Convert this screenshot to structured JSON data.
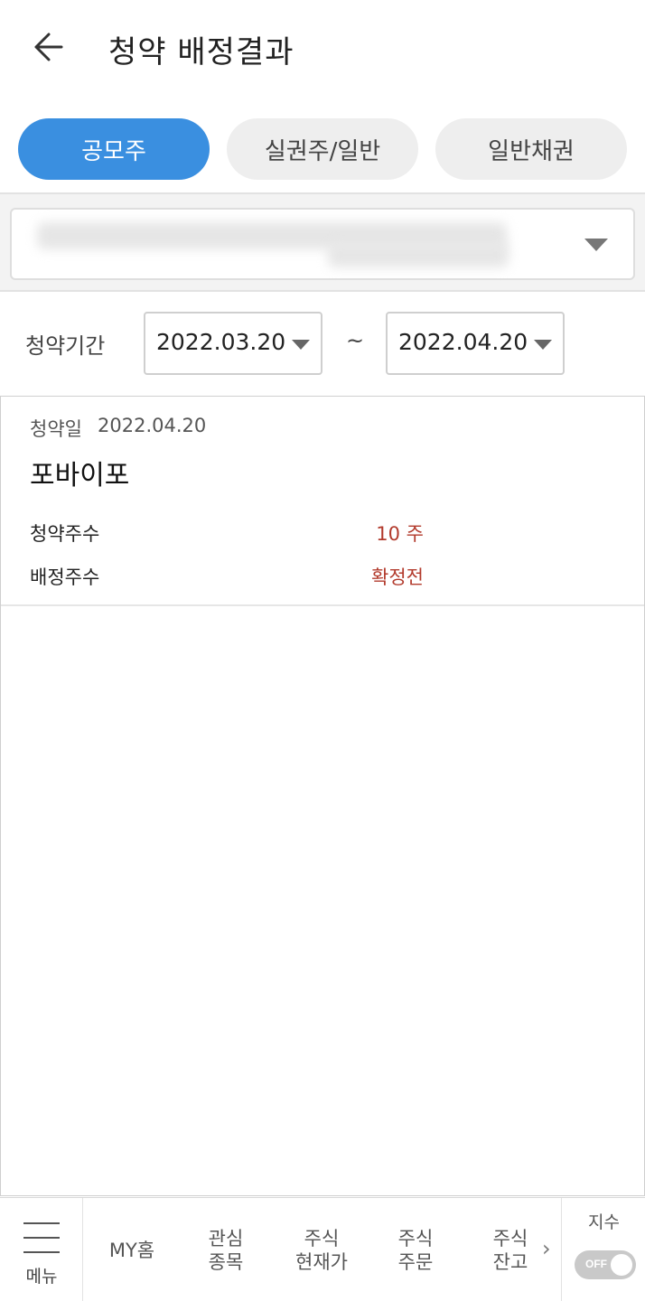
{
  "header": {
    "title": "청약 배정결과"
  },
  "tabs": [
    {
      "label": "공모주",
      "active": true
    },
    {
      "label": "실권주/일반",
      "active": false
    },
    {
      "label": "일반채권",
      "active": false
    }
  ],
  "period": {
    "label": "청약기간",
    "from": "2022.03.20",
    "separator": "~",
    "to": "2022.04.20"
  },
  "results": [
    {
      "date_label": "청약일",
      "date": "2022.04.20",
      "name": "포바이포",
      "subscribed_label": "청약주수",
      "subscribed_value": "10 주",
      "allotted_label": "배정주수",
      "allotted_value": "확정전"
    }
  ],
  "bottom_nav": {
    "menu_label": "메뉴",
    "items": [
      "MY홈",
      "관심\n종목",
      "주식\n현재가",
      "주식\n주문",
      "주식\n잔고"
    ],
    "index_label": "지수",
    "toggle_label": "OFF"
  },
  "colors": {
    "accent": "#3a8fe0",
    "value_red": "#b23a2c"
  }
}
